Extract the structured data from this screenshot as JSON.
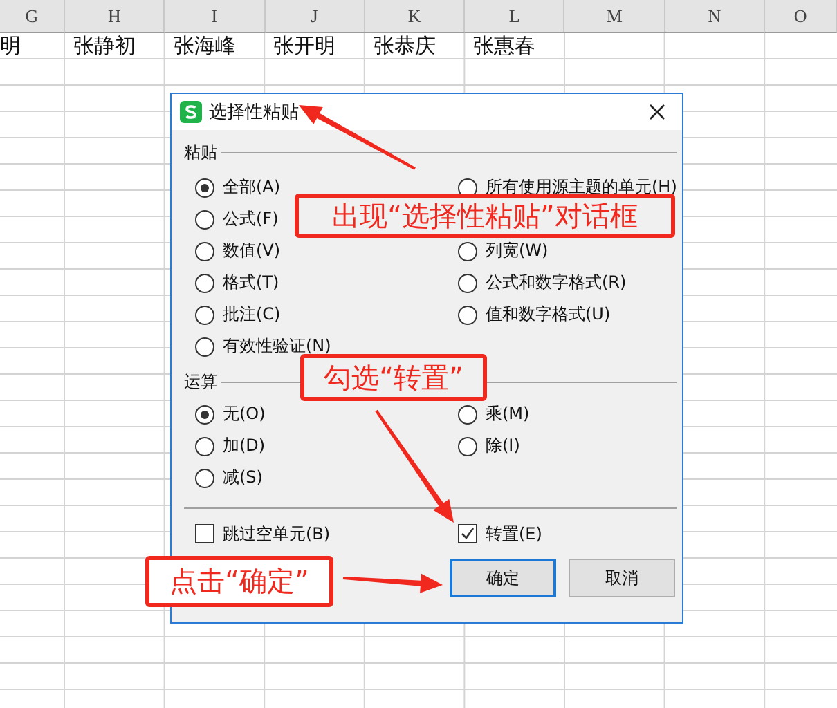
{
  "spreadsheet": {
    "columns": [
      "G",
      "H",
      "I",
      "J",
      "K",
      "L",
      "M",
      "N",
      "O"
    ],
    "rows": [
      [
        "明",
        "张静初",
        "张海峰",
        "张开明",
        "张恭庆",
        "张惠春",
        "",
        "",
        ""
      ]
    ]
  },
  "dialog": {
    "title": "选择性粘贴",
    "paste": {
      "label": "粘贴",
      "columns": [
        [
          {
            "label": "全部(A)",
            "selected": true
          },
          {
            "label": "公式(F)",
            "selected": false
          },
          {
            "label": "数值(V)",
            "selected": false
          },
          {
            "label": "格式(T)",
            "selected": false
          },
          {
            "label": "批注(C)",
            "selected": false
          },
          {
            "label": "有效性验证(N)",
            "selected": false
          }
        ],
        [
          {
            "label": "所有使用源主题的单元(H)",
            "selected": false
          },
          {
            "label": "列宽(W)",
            "selected": false
          },
          {
            "label": "公式和数字格式(R)",
            "selected": false
          },
          {
            "label": "值和数字格式(U)",
            "selected": false
          }
        ]
      ]
    },
    "operation": {
      "label": "运算",
      "options": [
        {
          "label": "无(O)",
          "selected": true
        },
        {
          "label": "乘(M)",
          "selected": false
        },
        {
          "label": "加(D)",
          "selected": false
        },
        {
          "label": "除(I)",
          "selected": false
        },
        {
          "label": "减(S)",
          "selected": false
        }
      ]
    },
    "checkboxes": [
      {
        "label": "跳过空单元(B)",
        "checked": false
      },
      {
        "label": "转置(E)",
        "checked": true
      }
    ],
    "buttons": [
      {
        "label": "确定",
        "default": true
      },
      {
        "label": "取消",
        "default": false
      }
    ]
  },
  "annotations": [
    {
      "text": "出现“选择性粘贴”对话框"
    },
    {
      "text": "勾选“转置”"
    },
    {
      "text": "点击“确定”"
    }
  ]
}
